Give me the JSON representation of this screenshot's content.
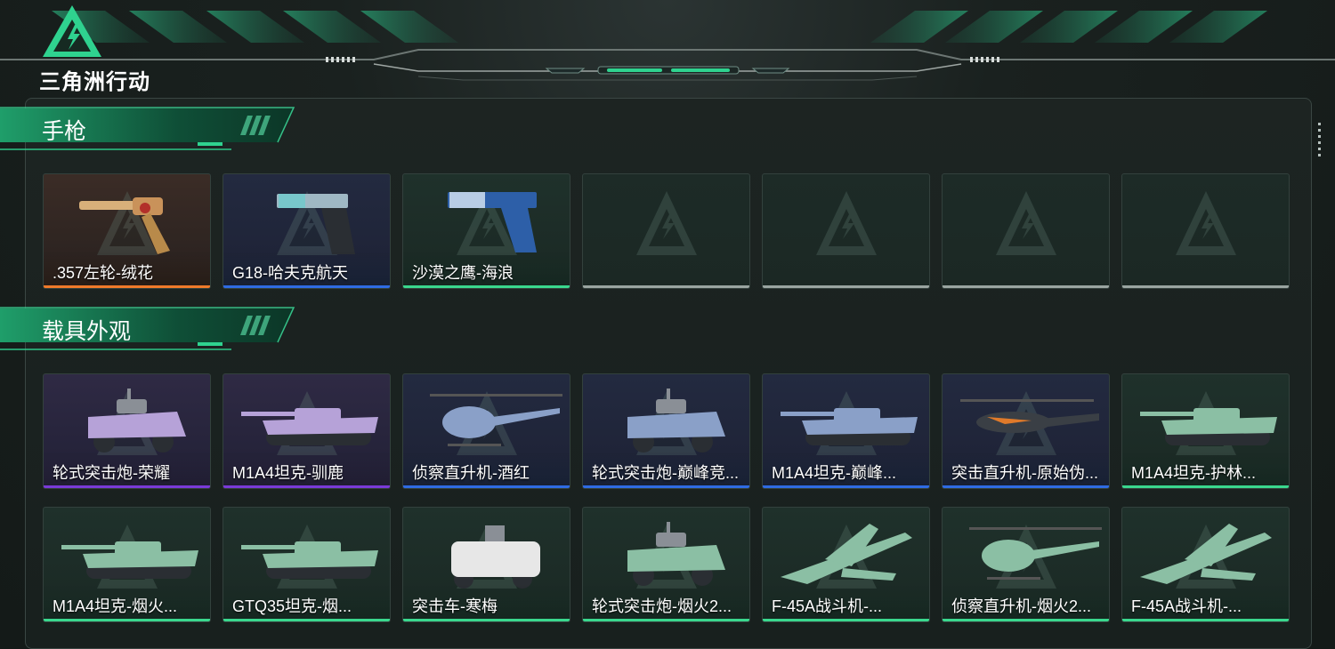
{
  "brand": {
    "logo_text": "三角洲行动"
  },
  "colors": {
    "accent": "#2fd28f",
    "rarity_orange": "#f07a2a",
    "rarity_blue": "#2f6be3",
    "rarity_green": "#3ad88e",
    "rarity_purple": "#7a3ad8",
    "rarity_empty": "#9aa5a1"
  },
  "sections": [
    {
      "title": "手枪",
      "items": [
        {
          "label": ".357左轮-绒花",
          "rarity": "orange",
          "icon": "revolver-icon"
        },
        {
          "label": "G18-哈夫克航天",
          "rarity": "blue",
          "icon": "pistol-icon"
        },
        {
          "label": "沙漠之鹰-海浪",
          "rarity": "green",
          "icon": "desert-eagle-icon"
        },
        {
          "label": "",
          "rarity": "empty"
        },
        {
          "label": "",
          "rarity": "empty"
        },
        {
          "label": "",
          "rarity": "empty"
        },
        {
          "label": "",
          "rarity": "empty"
        }
      ]
    },
    {
      "title": "载具外观",
      "items": [
        {
          "label": "轮式突击炮-荣耀",
          "rarity": "purple",
          "icon": "armored-car-icon"
        },
        {
          "label": "M1A4坦克-驯鹿",
          "rarity": "purple",
          "icon": "tank-icon"
        },
        {
          "label": "侦察直升机-酒红",
          "rarity": "blue",
          "icon": "helicopter-icon"
        },
        {
          "label": "轮式突击炮-巅峰竞...",
          "rarity": "blue",
          "icon": "armored-car-icon"
        },
        {
          "label": "M1A4坦克-巅峰...",
          "rarity": "blue",
          "icon": "tank-icon"
        },
        {
          "label": "突击直升机-原始伪...",
          "rarity": "blue",
          "icon": "attack-helicopter-icon"
        },
        {
          "label": "M1A4坦克-护林...",
          "rarity": "green",
          "icon": "tank-icon"
        },
        {
          "label": "M1A4坦克-烟火...",
          "rarity": "green",
          "icon": "tank-icon"
        },
        {
          "label": "GTQ35坦克-烟...",
          "rarity": "green",
          "icon": "tank-icon"
        },
        {
          "label": "突击车-寒梅",
          "rarity": "green",
          "icon": "assault-vehicle-icon"
        },
        {
          "label": "轮式突击炮-烟火2...",
          "rarity": "green",
          "icon": "armored-car-icon"
        },
        {
          "label": "F-45A战斗机-...",
          "rarity": "green",
          "icon": "fighter-jet-icon"
        },
        {
          "label": "侦察直升机-烟火2...",
          "rarity": "green",
          "icon": "helicopter-icon"
        },
        {
          "label": "F-45A战斗机-...",
          "rarity": "green",
          "icon": "fighter-jet-icon"
        }
      ]
    }
  ]
}
